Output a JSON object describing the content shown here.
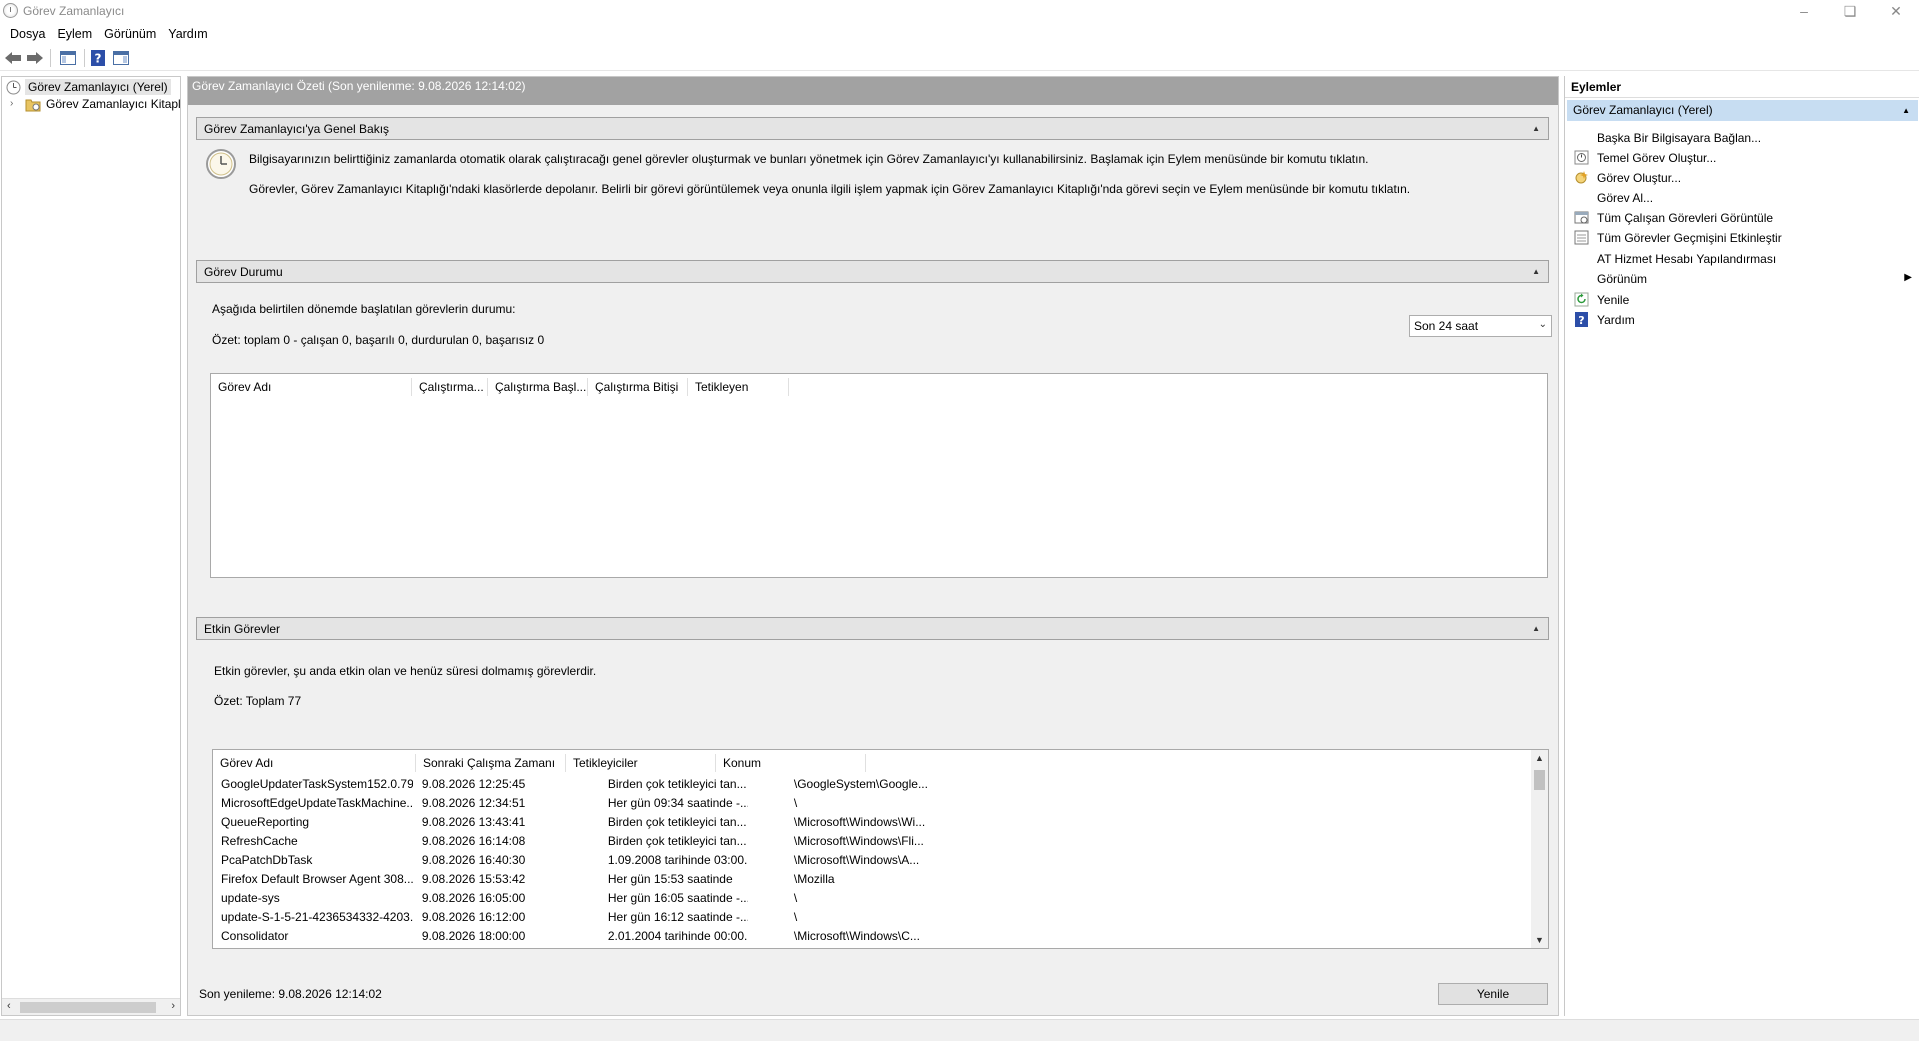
{
  "window": {
    "title": "Görev Zamanlayıcı"
  },
  "menu": [
    "Dosya",
    "Eylem",
    "Görünüm",
    "Yardım"
  ],
  "tree": {
    "root": "Görev Zamanlayıcı (Yerel)",
    "library": "Görev Zamanlayıcı Kitaplı"
  },
  "center": {
    "header": "Görev Zamanlayıcı Özeti (Son yenilenme: 9.08.2026 12:14:02)",
    "overview": {
      "title": "Görev Zamanlayıcı'ya Genel Bakış",
      "line1": "Bilgisayarınızın belirttiğiniz zamanlarda otomatik olarak çalıştıracağı genel görevler oluşturmak ve bunları yönetmek için Görev Zamanlayıcı'yı kullanabilirsiniz. Başlamak için Eylem menüsünde bir komutu tıklatın.",
      "line2": "Görevler, Görev Zamanlayıcı Kitaplığı'ndaki klasörlerde depolanır. Belirli bir görevi görüntülemek veya onunla ilgili işlem yapmak için Görev Zamanlayıcı Kitaplığı'nda görevi seçin ve Eylem menüsünde bir komutu tıklatın."
    },
    "status": {
      "title": "Görev Durumu",
      "prompt": "Aşağıda belirtilen dönemde başlatılan görevlerin durumu:",
      "period": "Son 24 saat",
      "summary": "Özet: toplam 0 - çalışan 0, başarılı 0, durdurulan 0, başarısız 0",
      "columns": [
        "Görev Adı",
        "Çalıştırma...",
        "Çalıştırma Başl...",
        "Çalıştırma Bitişi",
        "Tetikleyen"
      ]
    },
    "active": {
      "title": "Etkin Görevler",
      "description": "Etkin görevler, şu anda etkin olan ve henüz süresi dolmamış görevlerdir.",
      "total": "Özet: Toplam 77",
      "columns": [
        "Görev Adı",
        "Sonraki Çalışma Zamanı",
        "Tetikleyiciler",
        "Konum"
      ],
      "rows": [
        [
          "GoogleUpdaterTaskSystem152.0.79...",
          "9.08.2026 12:25:45",
          "Birden çok tetikleyici tan...",
          "\\GoogleSystem\\Google..."
        ],
        [
          "MicrosoftEdgeUpdateTaskMachine...",
          "9.08.2026 12:34:51",
          "Her gün 09:34 saatinde -...",
          "\\"
        ],
        [
          "QueueReporting",
          "9.08.2026 13:43:41",
          "Birden çok tetikleyici tan...",
          "\\Microsoft\\Windows\\Wi..."
        ],
        [
          "RefreshCache",
          "9.08.2026 16:14:08",
          "Birden çok tetikleyici tan...",
          "\\Microsoft\\Windows\\Fli..."
        ],
        [
          "PcaPatchDbTask",
          "9.08.2026 16:40:30",
          "1.09.2008 tarihinde 03:00...",
          "\\Microsoft\\Windows\\A..."
        ],
        [
          "Firefox Default Browser Agent 308...",
          "9.08.2026 15:53:42",
          "Her gün 15:53 saatinde",
          "\\Mozilla"
        ],
        [
          "update-sys",
          "9.08.2026 16:05:00",
          "Her gün 16:05 saatinde -...",
          "\\"
        ],
        [
          "update-S-1-5-21-4236534332-4203...",
          "9.08.2026 16:12:00",
          "Her gün 16:12 saatinde -...",
          "\\"
        ],
        [
          "Consolidator",
          "9.08.2026 18:00:00",
          "2.01.2004 tarihinde 00:00...",
          "\\Microsoft\\Windows\\C..."
        ]
      ]
    },
    "last_refresh": "Son yenileme: 9.08.2026 12:14:02",
    "refresh_button": "Yenile"
  },
  "actions": {
    "header": "Eylemler",
    "section": "Görev Zamanlayıcı (Yerel)",
    "items": [
      {
        "label": "Başka Bir Bilgisayara Bağlan...",
        "icon": "none"
      },
      {
        "label": "Temel Görev Oluştur...",
        "icon": "basic-task-icon"
      },
      {
        "label": "Görev Oluştur...",
        "icon": "create-task-icon"
      },
      {
        "label": "Görev Al...",
        "icon": "none"
      },
      {
        "label": "Tüm Çalışan Görevleri Görüntüle",
        "icon": "running-tasks-icon"
      },
      {
        "label": "Tüm Görevler Geçmişini Etkinleştir",
        "icon": "history-icon"
      },
      {
        "label": "AT Hizmet Hesabı Yapılandırması",
        "icon": "none"
      },
      {
        "label": "Görünüm",
        "icon": "none"
      },
      {
        "label": "Yenile",
        "icon": "refresh-icon"
      },
      {
        "label": "Yardım",
        "icon": "help-icon"
      }
    ]
  }
}
